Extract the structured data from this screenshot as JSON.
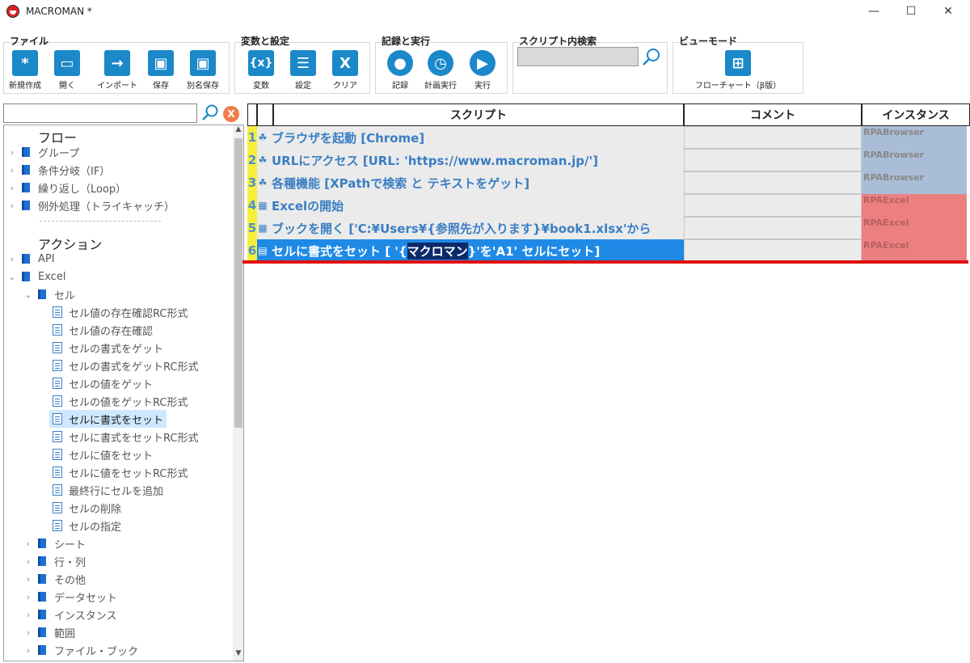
{
  "window": {
    "title": "MACROMAN *",
    "controls": {
      "minimize": "—",
      "maximize": "☐",
      "close": "✕"
    }
  },
  "ribbon": {
    "file": {
      "title": "ファイル",
      "buttons": [
        {
          "label": "新規作成",
          "glyph": "*"
        },
        {
          "label": "開く",
          "glyph": "▭"
        },
        {
          "label": "インポート",
          "glyph": "→"
        },
        {
          "label": "保存",
          "glyph": "▣"
        },
        {
          "label": "別名保存",
          "glyph": "▣"
        }
      ]
    },
    "variables": {
      "title": "変数と設定",
      "buttons": [
        {
          "label": "変数",
          "glyph": "{x}"
        },
        {
          "label": "設定",
          "glyph": "☰"
        },
        {
          "label": "クリア",
          "glyph": "X"
        }
      ]
    },
    "record": {
      "title": "記録と実行",
      "buttons": [
        {
          "label": "記録",
          "glyph": "●"
        },
        {
          "label": "計画実行",
          "glyph": "◷"
        },
        {
          "label": "実行",
          "glyph": "▶"
        }
      ]
    },
    "search": {
      "title": "スクリプト内検索",
      "value": ""
    },
    "view": {
      "title": "ビューモード",
      "buttons": [
        {
          "label": "フローチャート（β版）",
          "glyph": "⊞"
        }
      ]
    }
  },
  "left_search": {
    "value": "",
    "clear": "X"
  },
  "tree": {
    "flow_header": "フロー",
    "flow_items": [
      "グループ",
      "条件分岐（IF）",
      "繰り返し（Loop）",
      "例外処理（トライキャッチ）"
    ],
    "action_header": "アクション",
    "api": "API",
    "excel": "Excel",
    "cell": "セル",
    "cell_items": [
      "セル値の存在確認RC形式",
      "セル値の存在確認",
      "セルの書式をゲット",
      "セルの書式をゲットRC形式",
      "セルの値をゲット",
      "セルの値をゲットRC形式",
      "セルに書式をセット",
      "セルに書式をセットRC形式",
      "セルに値をセット",
      "セルに値をセットRC形式",
      "最終行にセルを追加",
      "セルの削除",
      "セルの指定"
    ],
    "excel_groups": [
      "シート",
      "行・列",
      "その他",
      "データセット",
      "インスタンス",
      "範囲",
      "ファイル・ブック"
    ]
  },
  "grid": {
    "headers": {
      "script": "スクリプト",
      "comment": "コメント",
      "instance": "インスタンス"
    },
    "rows": [
      {
        "num": "1",
        "icon": "☘",
        "text": "ブラウザを起動 [Chrome]",
        "comment": "",
        "instance": "RPABrowser"
      },
      {
        "num": "2",
        "icon": "☘",
        "text": "URLにアクセス [URL: 'https://www.macroman.jp/']",
        "comment": "",
        "instance": "RPABrowser"
      },
      {
        "num": "3",
        "icon": "☘",
        "text": "各種機能 [XPathで検索 と テキストをゲット]",
        "comment": "",
        "instance": "RPABrowser"
      },
      {
        "num": "4",
        "icon": "▦",
        "text": "Excelの開始",
        "comment": "",
        "instance": "RPAExcel"
      },
      {
        "num": "5",
        "icon": "▦",
        "text": "ブックを開く ['C:¥Users¥{参照先が入ります}¥book1.xlsx'から",
        "comment": "",
        "instance": "RPAExcel"
      },
      {
        "num": "6",
        "icon": "▤",
        "text_pre": "セルに書式をセット [ '{",
        "text_hl": "マクロマン",
        "text_post": "}'を'A1' セルにセット]",
        "comment": "",
        "instance": "RPAExcel"
      }
    ]
  },
  "colors": {
    "accent": "#1a88c9",
    "browser_instance": "#aabdd6",
    "excel_instance": "#ec8080",
    "row_number": "#f6ee3c",
    "selected_row": "#1f8ae6",
    "end_line": "#e01010"
  }
}
